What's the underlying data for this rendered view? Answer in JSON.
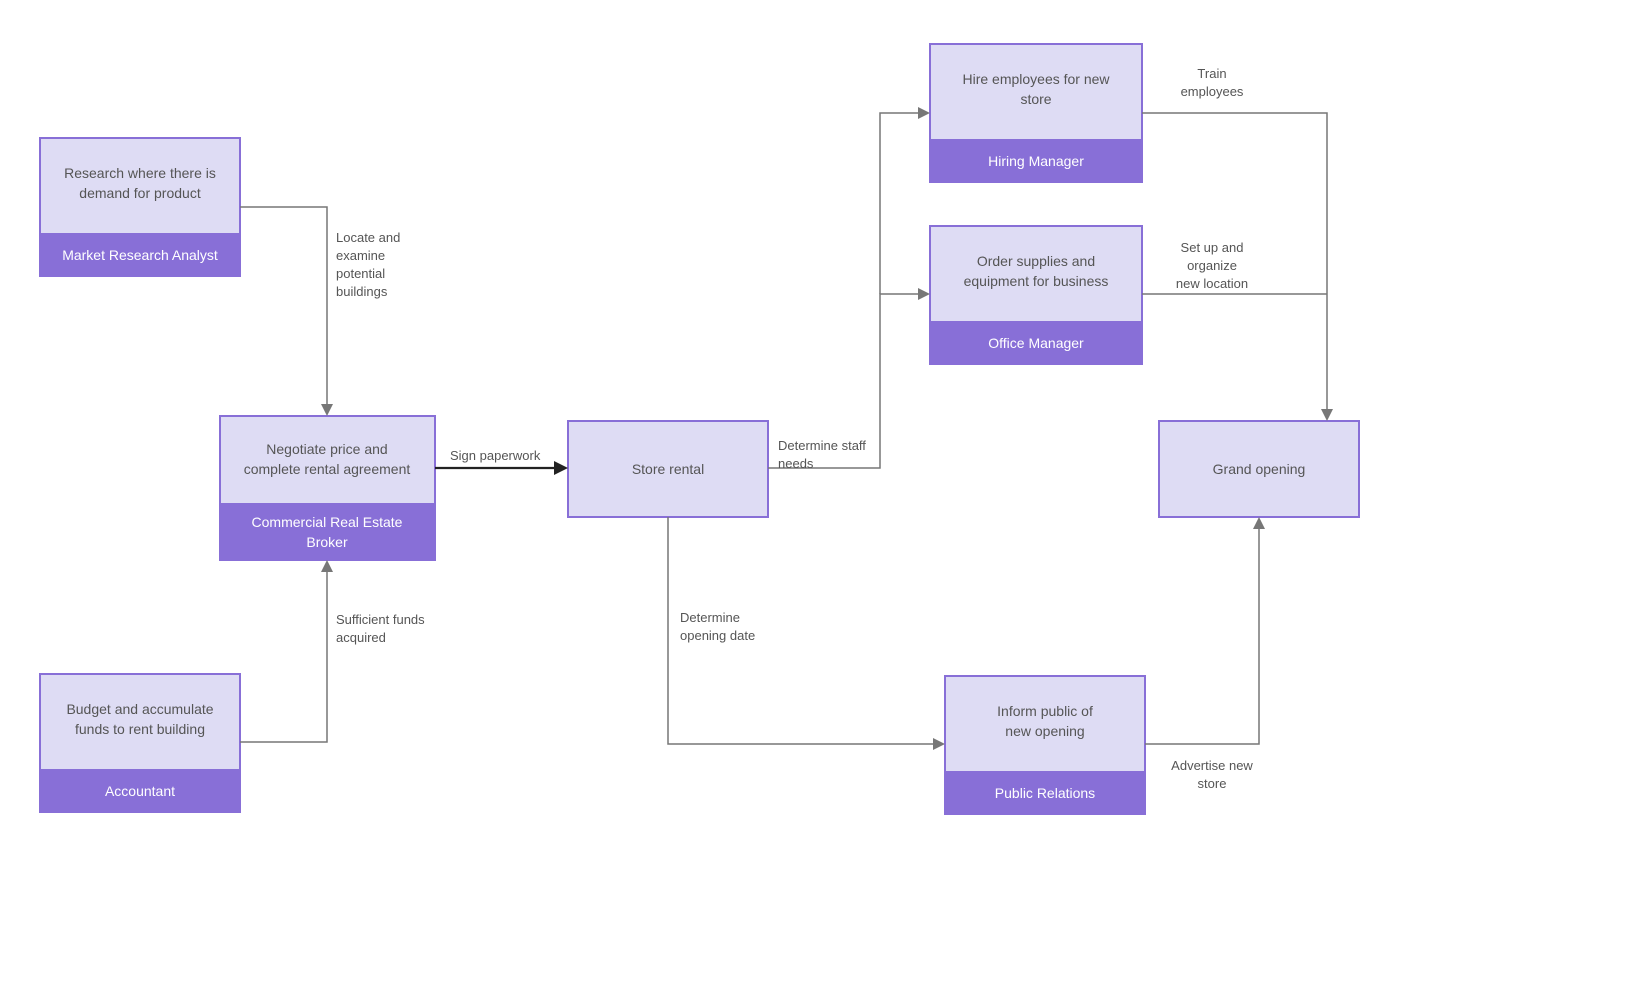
{
  "nodes": {
    "research": {
      "title1": "Research where there is",
      "title2": "demand for product",
      "footer": "Market Research Analyst"
    },
    "budget": {
      "title1": "Budget and accumulate",
      "title2": "funds to rent building",
      "footer": "Accountant"
    },
    "negotiate": {
      "title1": "Negotiate price and",
      "title2": "complete rental agreement",
      "footer1": "Commercial Real Estate",
      "footer2": "Broker"
    },
    "store": {
      "title": "Store rental"
    },
    "hire": {
      "title1": "Hire employees for new",
      "title2": "store",
      "footer": "Hiring Manager"
    },
    "supplies": {
      "title1": "Order supplies and",
      "title2": "equipment for business",
      "footer": "Office Manager"
    },
    "inform": {
      "title1": "Inform public of",
      "title2": "new opening",
      "footer": "Public Relations"
    },
    "grand": {
      "title": "Grand opening"
    }
  },
  "edges": {
    "locate": {
      "l1": "Locate and",
      "l2": "examine",
      "l3": "potential",
      "l4": "buildings"
    },
    "sufficient": {
      "l1": "Sufficient funds",
      "l2": "acquired"
    },
    "sign": {
      "l1": "Sign paperwork"
    },
    "staff": {
      "l1": "Determine staff",
      "l2": "needs"
    },
    "date": {
      "l1": "Determine",
      "l2": "opening date"
    },
    "train": {
      "l1": "Train",
      "l2": "employees"
    },
    "setup": {
      "l1": "Set up and",
      "l2": "organize",
      "l3": "new location"
    },
    "advertise": {
      "l1": "Advertise new",
      "l2": "store"
    }
  }
}
